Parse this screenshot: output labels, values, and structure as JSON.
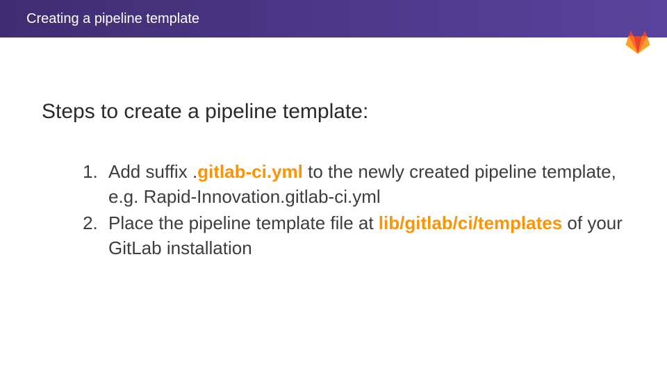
{
  "header": {
    "title": "Creating a pipeline template"
  },
  "content": {
    "heading": "Steps to create a pipeline template:"
  },
  "steps": [
    {
      "pre": "Add suffix ",
      "dot": ".",
      "highlight": "gitlab-ci.yml",
      "post": " to the newly created pipeline template, e.g. Rapid-Innovation.gitlab-ci.yml"
    },
    {
      "pre": "Place the pipeline template file at ",
      "dot": "",
      "highlight": "lib/gitlab/ci/templates",
      "post": " of your GitLab installation"
    }
  ]
}
